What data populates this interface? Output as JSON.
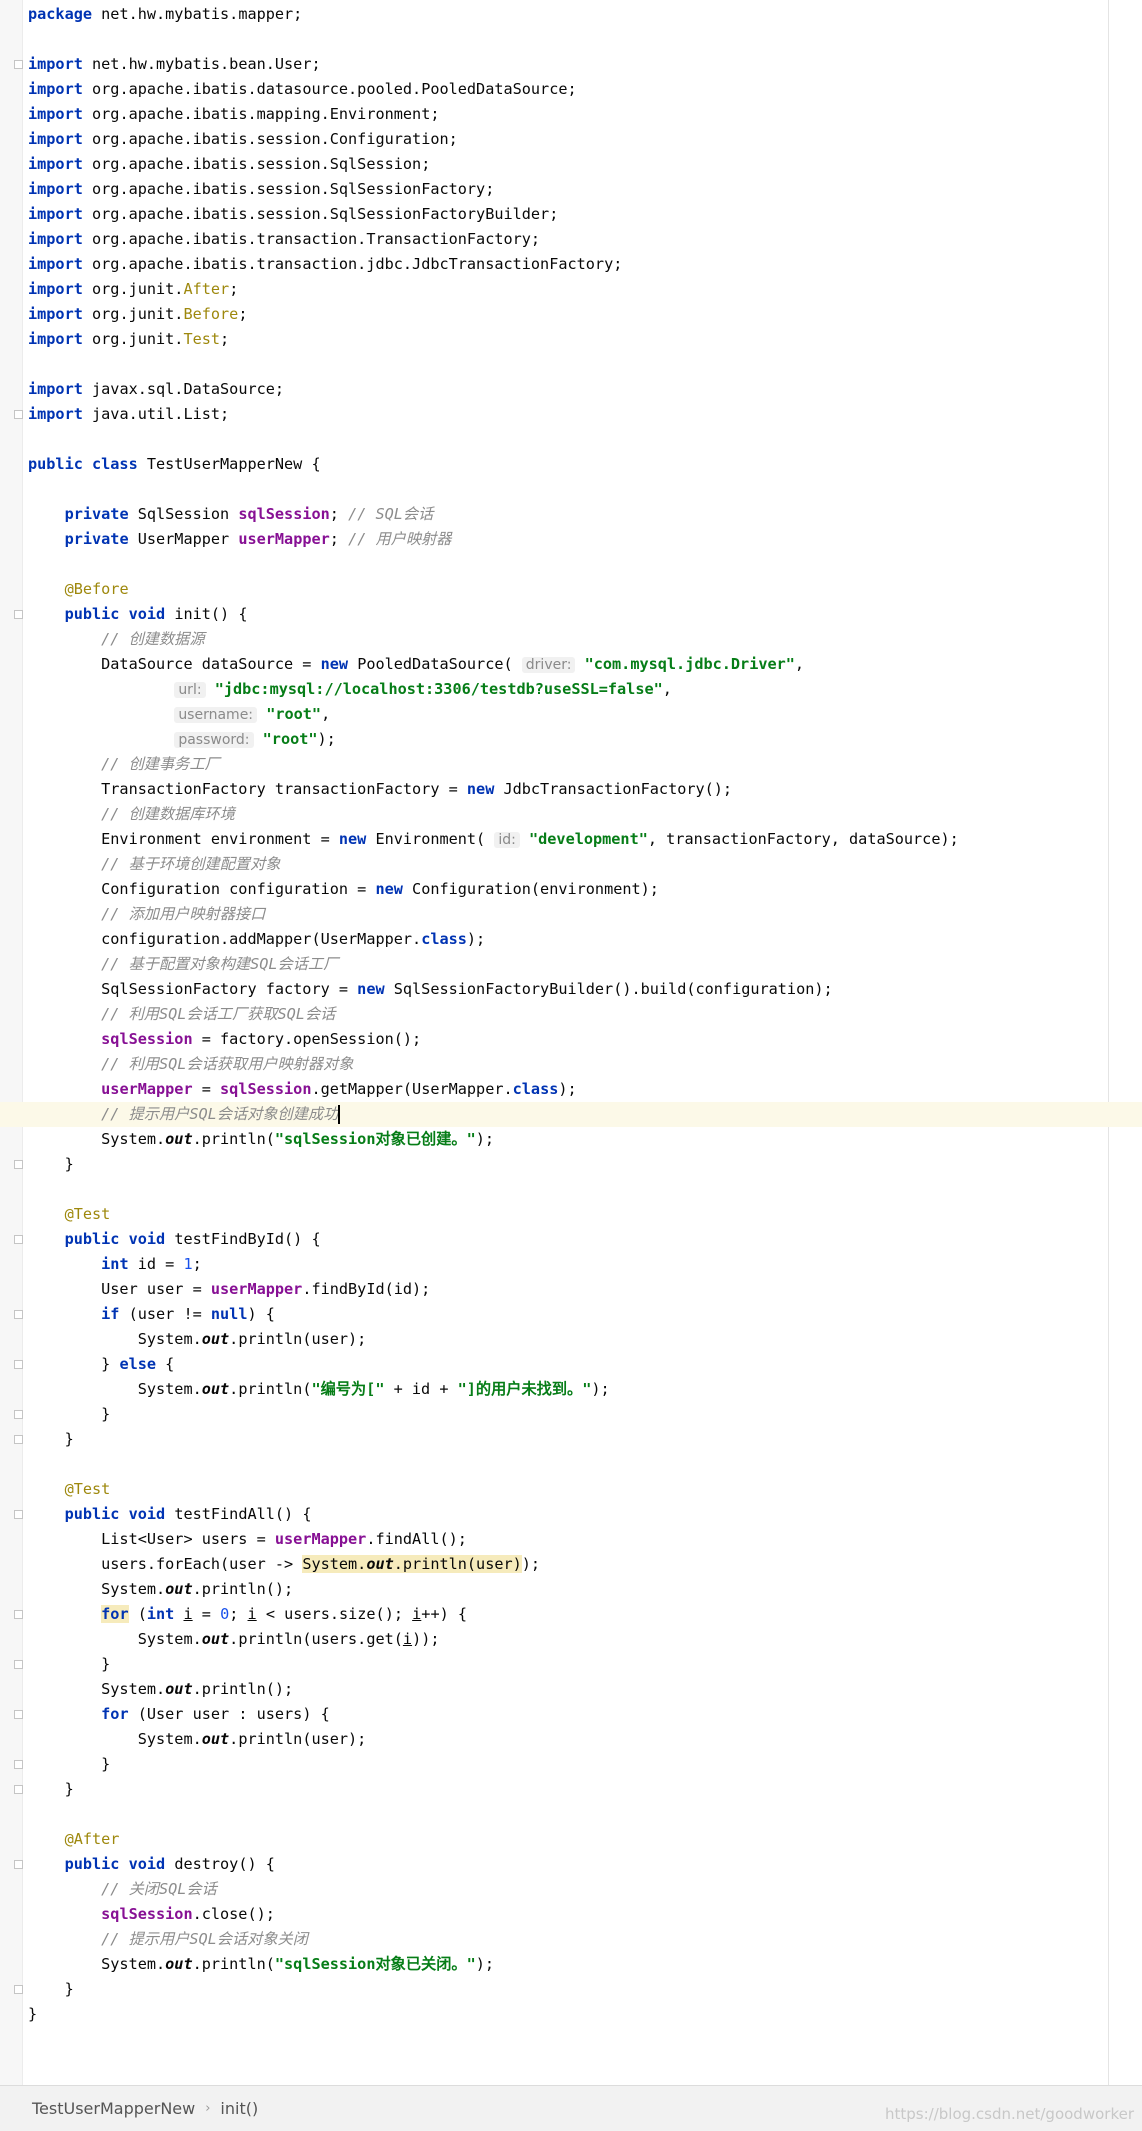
{
  "breadcrumb": {
    "items": [
      {
        "label": "TestUserMapperNew"
      },
      {
        "label": "init()"
      }
    ],
    "separator": "›"
  },
  "watermark": "https://blog.csdn.net/goodworker",
  "hints": {
    "driver": "driver:",
    "url": "url:",
    "username": "username:",
    "password": "password:",
    "id": "id:"
  },
  "strings": {
    "driver": "\"com.mysql.jdbc.Driver\"",
    "url": "\"jdbc:mysql://localhost:3306/testdb?useSSL=false\"",
    "username": "\"root\"",
    "password": "\"root\"",
    "env": "\"development\"",
    "created": "\"sqlSession对象已创建。\"",
    "notfound_a": "\"编号为[\"",
    "notfound_b": "\"]的用户未找到。\"",
    "closed": "\"sqlSession对象已关闭。\""
  },
  "comments": {
    "sqlsession": "// SQL会话",
    "usermapper": "// 用户映射器",
    "c1": "// 创建数据源",
    "c2": "// 创建事务工厂",
    "c3": "// 创建数据库环境",
    "c4": "// 基于环境创建配置对象",
    "c5": "// 添加用户映射器接口",
    "c6": "// 基于配置对象构建SQL会话工厂",
    "c7": "// 利用SQL会话工厂获取SQL会话",
    "c8": "// 利用SQL会话获取用户映射器对象",
    "c9": "// 提示用户SQL会话对象创建成功",
    "c10": "// 关闭SQL会话",
    "c11": "// 提示用户SQL会话对象关闭"
  },
  "code": {
    "package_name": " net.hw.mybatis.mapper;",
    "imports": [
      " net.hw.mybatis.bean.User;",
      " org.apache.ibatis.datasource.pooled.PooledDataSource;",
      " org.apache.ibatis.mapping.Environment;",
      " org.apache.ibatis.session.Configuration;",
      " org.apache.ibatis.session.SqlSession;",
      " org.apache.ibatis.session.SqlSessionFactory;",
      " org.apache.ibatis.session.SqlSessionFactoryBuilder;",
      " org.apache.ibatis.transaction.TransactionFactory;",
      " org.apache.ibatis.transaction.jdbc.JdbcTransactionFactory;"
    ],
    "junit_prefix": " org.junit.",
    "junit_names": [
      "After",
      "Before",
      "Test"
    ],
    "imports2": [
      " javax.sql.DataSource;",
      " java.util.List;"
    ],
    "class_name": " TestUserMapperNew {"
  }
}
